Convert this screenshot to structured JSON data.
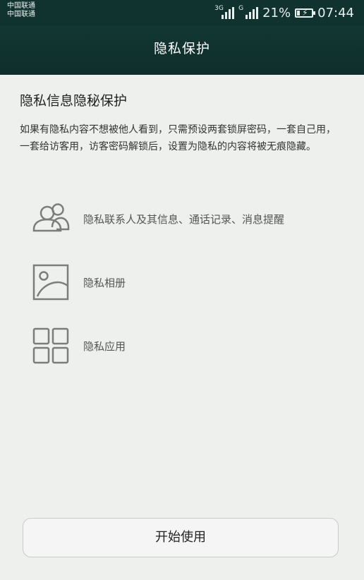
{
  "status_bar": {
    "carrier_1": "中国联通",
    "carrier_2": "中国联通",
    "network_tag_1": "3G",
    "network_tag_2": "G",
    "battery_percent": "21%",
    "time": "07:44"
  },
  "header": {
    "title": "隐私保护"
  },
  "main": {
    "heading": "隐私信息隐秘保护",
    "description": "如果有隐私内容不想被他人看到，只需预设两套锁屏密码，一套自己用，一套给访客用，访客密码解锁后，设置为隐私的内容将被无痕隐藏。",
    "features": [
      {
        "label": "隐私联系人及其信息、通话记录、消息提醒",
        "icon": "contacts-icon"
      },
      {
        "label": "隐私相册",
        "icon": "gallery-icon"
      },
      {
        "label": "隐私应用",
        "icon": "apps-grid-icon"
      }
    ]
  },
  "footer": {
    "start_label": "开始使用"
  }
}
